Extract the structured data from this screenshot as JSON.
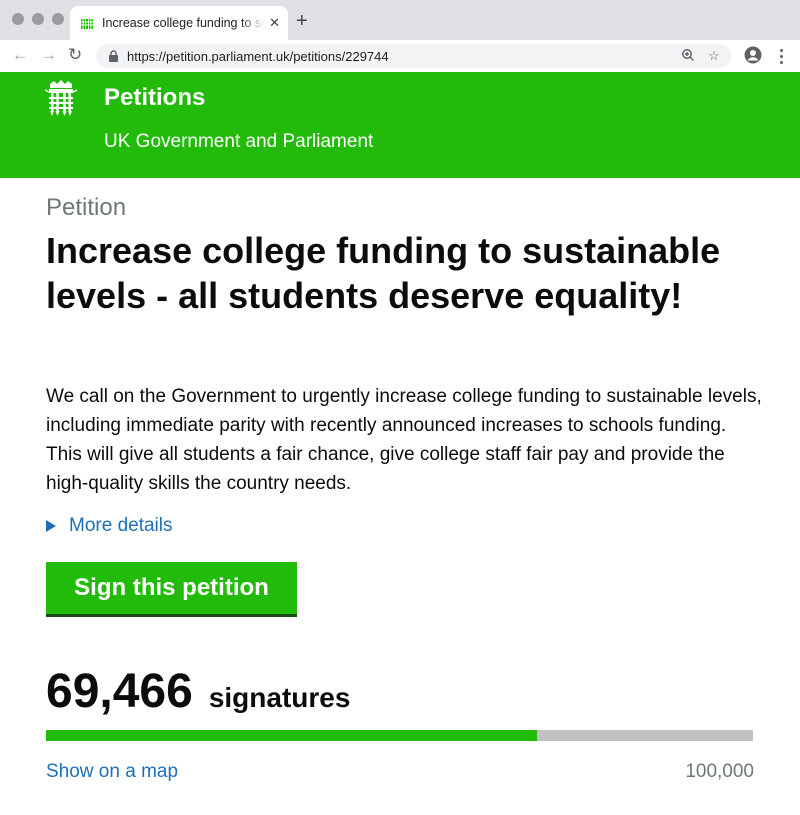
{
  "browser": {
    "tab_title": "Increase college funding to sustainable levels - all students deserve equality!",
    "url": "https://petition.parliament.uk/petitions/229744",
    "icons": {
      "back": "arrow-left-icon",
      "forward": "arrow-right-icon",
      "reload": "reload-icon",
      "lock": "lock-icon",
      "zoom": "zoom-icon",
      "bookmark": "star-icon",
      "profile": "account-icon",
      "menu": "kebab-menu-icon",
      "new_tab": "plus-icon",
      "close_tab": "close-icon"
    }
  },
  "header": {
    "site_name": "Petitions",
    "subtitle": "UK Government and Parliament",
    "logo": "portcullis-icon",
    "brand_color": "#22bb0a"
  },
  "petition": {
    "caption": "Petition",
    "title": "Increase college funding to sustainable levels - all students deserve equality!",
    "body": "We call on the Government to urgently increase college funding to sustainable levels, including immediate parity with recently announced increases to schools funding. This will give all students a fair chance, give college staff fair pay and provide the high-quality skills the country needs.",
    "more_details_label": "More details",
    "sign_button_label": "Sign this petition"
  },
  "signatures": {
    "count_text": "69,466",
    "label": "signatures",
    "count": 69466,
    "target": 100000,
    "target_text": "100,000",
    "progress_fraction": 0.69466,
    "map_link_label": "Show on a map"
  },
  "colors": {
    "link": "#1d70b8",
    "text": "#0b0c0c",
    "secondary_text": "#6f777b",
    "progress_track": "#bfc1c3"
  }
}
